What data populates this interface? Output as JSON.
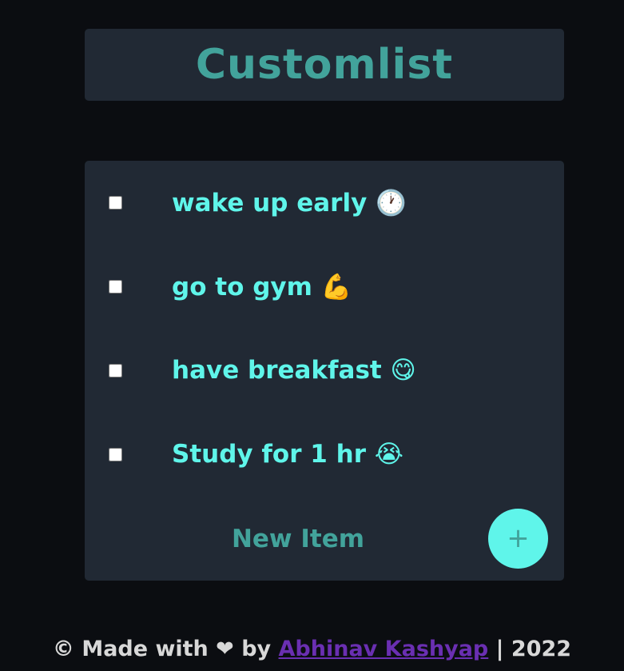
{
  "header": {
    "title": "Customlist"
  },
  "items": [
    {
      "text": "wake up early 🕐",
      "checked": false
    },
    {
      "text": "go to gym 💪",
      "checked": false
    },
    {
      "text": "have breakfast 😋",
      "checked": false
    },
    {
      "text": "Study for 1 hr 😭",
      "checked": false
    }
  ],
  "new_item": {
    "placeholder": "New Item",
    "add_label": "+"
  },
  "footer": {
    "prefix": "© Made with ❤ by ",
    "author": "Abhinav Kashyap",
    "suffix": " | 2022"
  },
  "colors": {
    "background": "#0b0d11",
    "panel": "#212934",
    "title": "#42a39b",
    "item_text": "#5ff5ea",
    "button_bg": "#5ff5ea",
    "link": "#6a2fb2"
  }
}
